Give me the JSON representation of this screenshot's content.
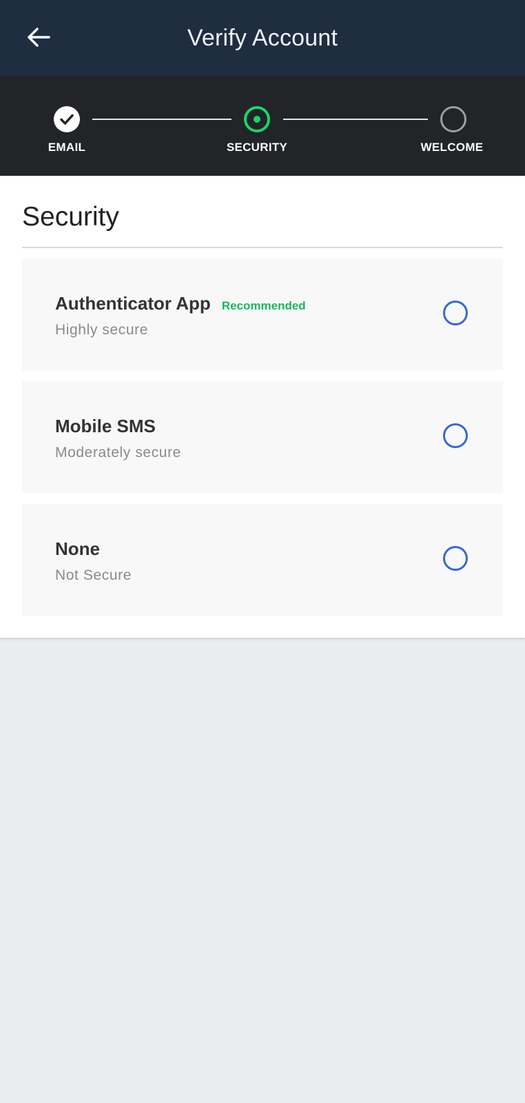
{
  "appbar": {
    "title": "Verify Account",
    "back_icon": "arrow-left-icon"
  },
  "stepper": {
    "steps": [
      {
        "label": "EMAIL",
        "state": "completed",
        "icon": "check-icon"
      },
      {
        "label": "SECURITY",
        "state": "current",
        "icon": "dot-ring-icon"
      },
      {
        "label": "WELCOME",
        "state": "upcoming",
        "icon": "empty-ring-icon"
      }
    ]
  },
  "main": {
    "title": "Security",
    "options": [
      {
        "title": "Authenticator App",
        "badge": "Recommended",
        "subtitle": "Highly secure",
        "selected": false
      },
      {
        "title": "Mobile SMS",
        "subtitle": "Moderately secure",
        "selected": false
      },
      {
        "title": "None",
        "subtitle": "Not Secure",
        "selected": false
      }
    ]
  },
  "colors": {
    "appbar_bg": "#1f2d40",
    "stepper_bg": "#222428",
    "accent_green": "#19b85a",
    "radio_blue": "#3568d4",
    "page_bg": "#e9edf0"
  }
}
